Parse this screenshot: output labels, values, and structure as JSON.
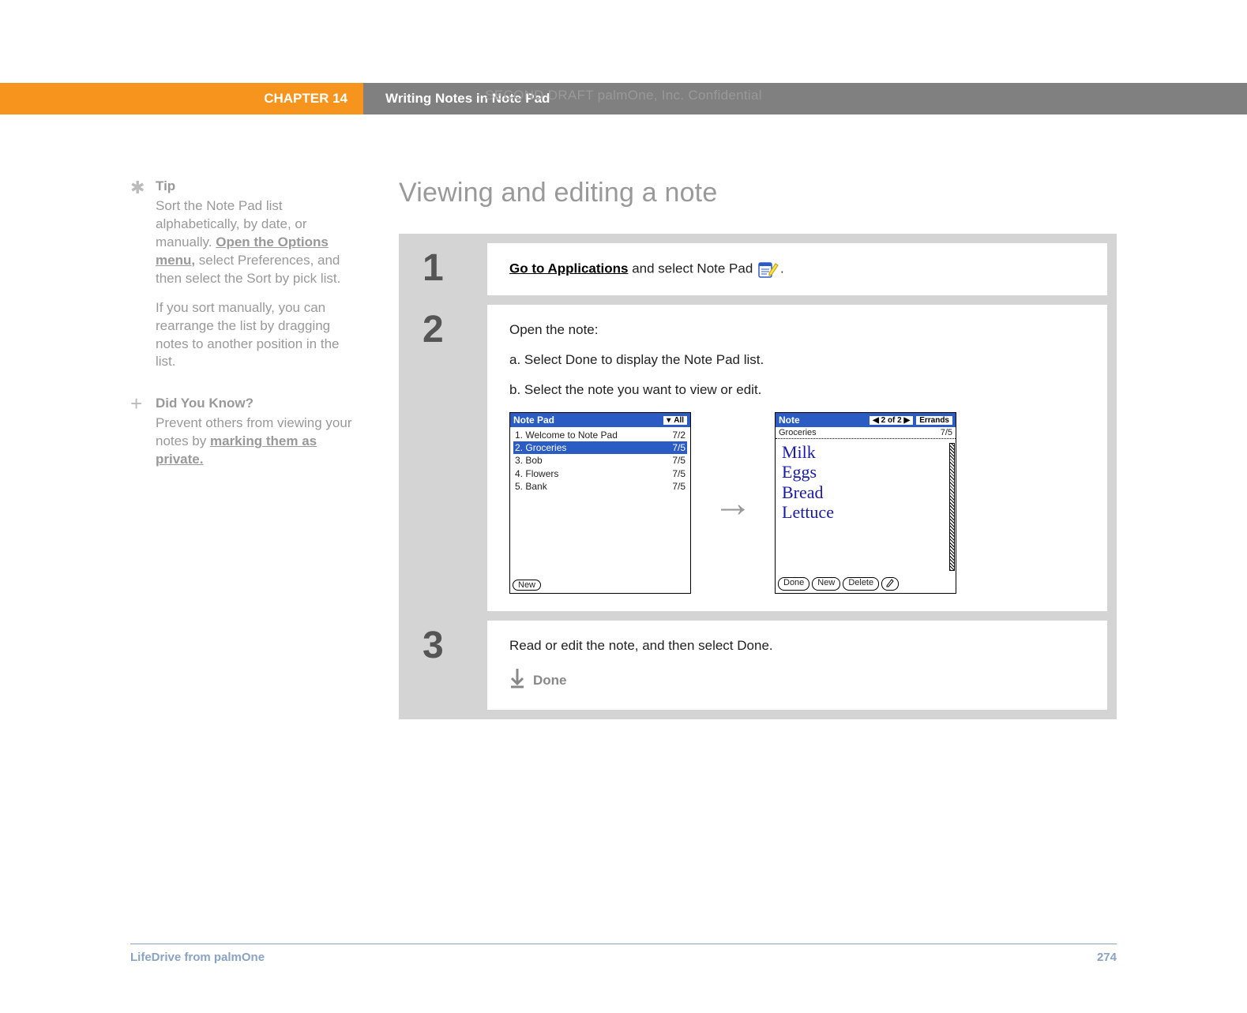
{
  "draft_header": "SECOND DRAFT palmOne, Inc.  Confidential",
  "banner": {
    "chapter": "CHAPTER 14",
    "title": "Writing Notes in Note Pad"
  },
  "sidebar": {
    "tip": {
      "title": "Tip",
      "body_pre": "Sort the Note Pad list alphabetically, by date, or manually. ",
      "link": "Open the Options menu,",
      "body_post": " select Preferences, and then select the Sort by pick list.",
      "para2": "If you sort manually, you can rearrange the list by dragging notes to another position in the list."
    },
    "dyk": {
      "title": "Did You Know?",
      "body_pre": "Prevent others from viewing your notes by ",
      "link": "marking them as private."
    }
  },
  "main_title": "Viewing and editing a note",
  "steps": {
    "s1": {
      "num": "1",
      "link": "Go to Applications",
      "post": " and select Note Pad ",
      "period": "."
    },
    "s2": {
      "num": "2",
      "intro": "Open the note:",
      "a": "a.  Select Done to display the Note Pad list.",
      "b": "b.  Select the note you want to view or edit."
    },
    "s3": {
      "num": "3",
      "text": "Read or edit the note, and then select Done.",
      "done": "Done"
    }
  },
  "screen_left": {
    "title": "Note Pad",
    "category": "All",
    "rows": [
      {
        "n": "1.",
        "t": "Welcome to Note Pad",
        "d": "7/2"
      },
      {
        "n": "2.",
        "t": "Groceries",
        "d": "7/5"
      },
      {
        "n": "3.",
        "t": "Bob",
        "d": "7/5"
      },
      {
        "n": "4.",
        "t": "Flowers",
        "d": "7/5"
      },
      {
        "n": "5.",
        "t": "Bank",
        "d": "7/5"
      }
    ],
    "selected_index": 1,
    "btn_new": "New"
  },
  "screen_right": {
    "title": "Note",
    "nav": "2 of 2",
    "category": "Errands",
    "note_title": "Groceries",
    "note_date": "7/5",
    "lines": [
      "Milk",
      "Eggs",
      "Bread",
      "Lettuce"
    ],
    "btn_done": "Done",
    "btn_new": "New",
    "btn_delete": "Delete"
  },
  "footer": {
    "product": "LifeDrive from palmOne",
    "page": "274"
  }
}
